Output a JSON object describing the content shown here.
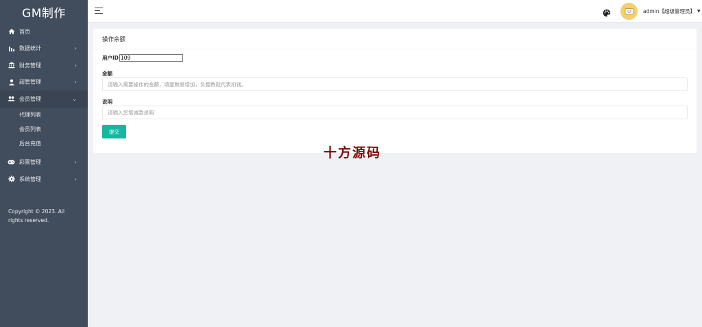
{
  "sidebar": {
    "logo": "GM制作",
    "items": [
      {
        "label": "首页",
        "icon": "home-icon",
        "arrow": ""
      },
      {
        "label": "数据统计",
        "icon": "bar-chart-icon",
        "arrow": "›"
      },
      {
        "label": "财务管理",
        "icon": "bank-icon",
        "arrow": "›"
      },
      {
        "label": "超管管理",
        "icon": "user-icon",
        "arrow": "›"
      },
      {
        "label": "会员管理",
        "icon": "users-icon",
        "arrow": "⌄"
      }
    ],
    "submenu": [
      "代理列表",
      "会员列表",
      "后台充值"
    ],
    "items_after": [
      {
        "label": "彩票管理",
        "icon": "gamepad-icon",
        "arrow": "›"
      },
      {
        "label": "系统管理",
        "icon": "gear-icon",
        "arrow": "›"
      }
    ],
    "copyright": "Copyright © 2023. All rights reserved."
  },
  "header": {
    "user": "admin【超级管理员】",
    "caret": "▼"
  },
  "card": {
    "title": "操作余额",
    "userid_label": "用户ID",
    "userid_value": "109",
    "amount_label": "金额",
    "amount_placeholder": "请输入需要操作的金额，填整数是增加，负整数就代表扣钱。",
    "note_label": "说明",
    "note_placeholder": "请输入您增减款说明",
    "submit": "提交"
  },
  "watermark": "十方源码",
  "colors": {
    "sidebar_bg": "#414c5c",
    "accent": "#16b7a0",
    "watermark": "#7b0c0c",
    "avatar_bg": "#f5cf6f"
  }
}
